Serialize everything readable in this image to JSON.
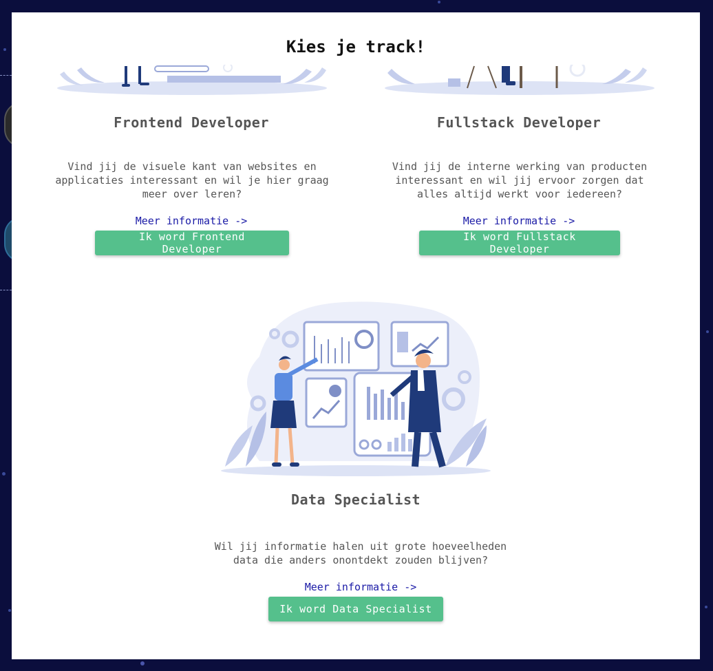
{
  "modal": {
    "title": "Kies je track!"
  },
  "tracks": [
    {
      "title": "Frontend Developer",
      "description": "Vind jij de visuele kant van websites en applicaties interessant en wil je hier graag meer over leren?",
      "link_label": "Meer informatie ->",
      "button_label": "Ik word Frontend Developer"
    },
    {
      "title": "Fullstack Developer",
      "description": "Vind jij de interne werking van producten interessant en wil jij ervoor zorgen dat alles altijd werkt voor iedereen?",
      "link_label": "Meer informatie ->",
      "button_label": "Ik word Fullstack Developer"
    },
    {
      "title": "Data Specialist",
      "description": "Wil jij informatie halen uit grote hoeveelheden data die anders onontdekt zouden blijven?",
      "link_label": "Meer informatie ->",
      "button_label": "Ik word Data Specialist"
    }
  ],
  "colors": {
    "background": "#0b0e3d",
    "button": "#55c08c",
    "link": "#1a1aa6",
    "illustration_light": "#dde3f5",
    "illustration_dark": "#1f3a7a"
  }
}
